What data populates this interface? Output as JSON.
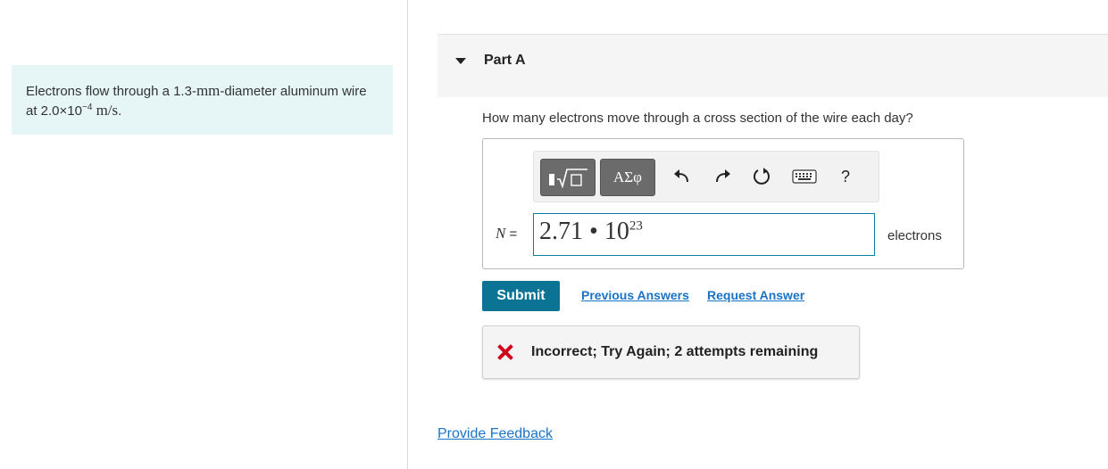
{
  "problem": {
    "text_1": "Electrons flow through a 1.3-",
    "unit_mm": "mm",
    "text_2": "-diameter aluminum wire at 2.0×10",
    "exponent": "−4",
    "speed_unit": "m/s",
    "text_3": "."
  },
  "part": {
    "label": "Part A",
    "question": "How many electrons move through a cross section of the wire each day?"
  },
  "toolbar": {
    "greek_label": "ΑΣφ",
    "help_label": "?"
  },
  "answer": {
    "variable": "N",
    "equals": " =",
    "mantissa": "2.71",
    "bullet": " • ",
    "base": "10",
    "exponent": "23",
    "unit": "electrons"
  },
  "actions": {
    "submit": "Submit",
    "previous_answers": "Previous Answers",
    "request_answer": "Request Answer"
  },
  "feedback": {
    "message": "Incorrect; Try Again; 2 attempts remaining"
  },
  "footer": {
    "provide_feedback": "Provide Feedback"
  },
  "colors": {
    "accent": "#0b7393",
    "link": "#1a73c7",
    "error": "#d0021b",
    "problem_bg": "#e6f5f6"
  }
}
